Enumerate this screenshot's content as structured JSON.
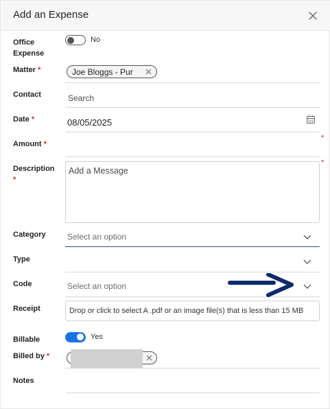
{
  "dialog": {
    "title": "Add an Expense"
  },
  "fields": {
    "office_expense": {
      "label": "Office Expense",
      "toggle_text": "No"
    },
    "matter": {
      "label": "Matter",
      "chip": "Joe Bloggs - Pur"
    },
    "contact": {
      "label": "Contact",
      "placeholder": "Search"
    },
    "date": {
      "label": "Date",
      "value": "08/05/2025"
    },
    "amount": {
      "label": "Amount"
    },
    "description": {
      "label": "Description",
      "placeholder": "Add a Message"
    },
    "category": {
      "label": "Category",
      "placeholder": "Select an option"
    },
    "type": {
      "label": "Type"
    },
    "code": {
      "label": "Code",
      "placeholder": "Select an option"
    },
    "receipt": {
      "label": "Receipt",
      "dropzone_text": "Drop or click to select A .pdf or an image file(s) that is less than 15 MB"
    },
    "billable": {
      "label": "Billable",
      "toggle_text": "Yes"
    },
    "billed_by": {
      "label": "Billed by"
    },
    "notes": {
      "label": "Notes"
    }
  },
  "required_marker": "*",
  "colors": {
    "accent": "#1a73e8",
    "required": "#d32f2f",
    "annotation_arrow": "#0d2a6b"
  }
}
